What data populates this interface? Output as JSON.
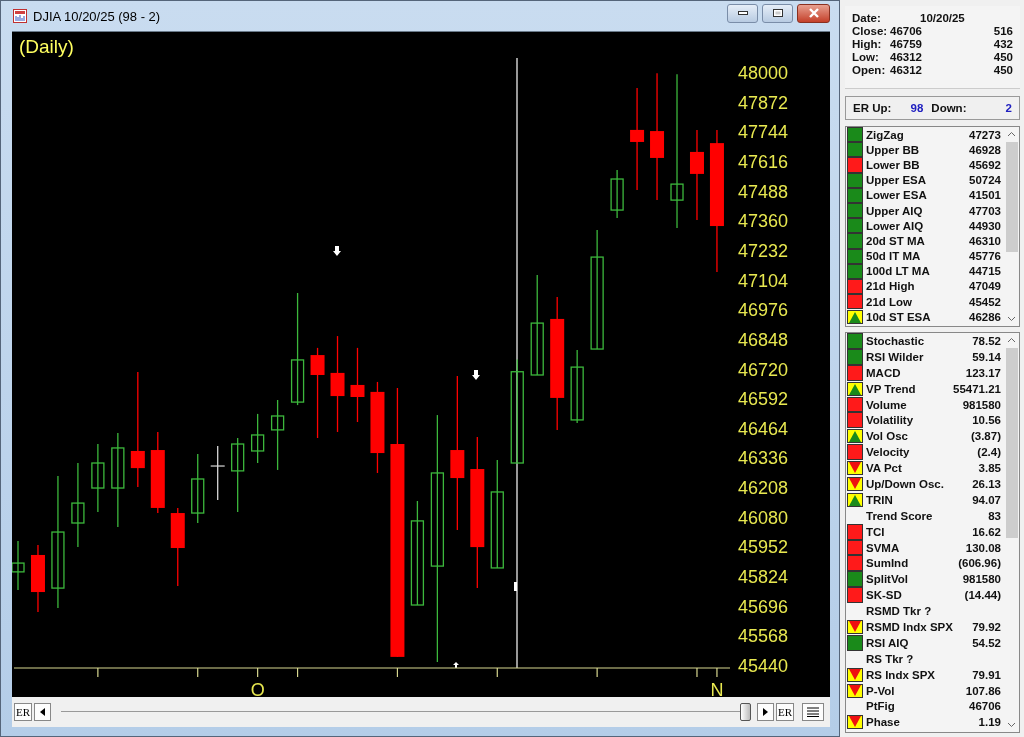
{
  "window": {
    "title": "DJIA 10/20/25 (98 - 2)"
  },
  "chart": {
    "period": "(Daily)",
    "chart_data": {
      "type": "candlestick",
      "ylim": [
        45440,
        48000
      ],
      "yticks": [
        48000,
        47872,
        47744,
        47616,
        47488,
        47360,
        47232,
        47104,
        46976,
        46848,
        46720,
        46592,
        46464,
        46336,
        46208,
        46080,
        45952,
        45824,
        45696,
        45568,
        45440
      ],
      "categories": [
        null,
        null,
        null,
        null,
        null,
        null,
        null,
        null,
        null,
        null,
        null,
        null,
        "O",
        null,
        null,
        null,
        null,
        null,
        null,
        null,
        null,
        null,
        null,
        null,
        null,
        null,
        null,
        null,
        null,
        null,
        null,
        null,
        null,
        null,
        null,
        "N"
      ],
      "ohlc": [
        [
          45842,
          45975,
          45764,
          45880
        ],
        [
          45915,
          45958,
          45669,
          45755
        ],
        [
          45772,
          46256,
          45686,
          46014
        ],
        [
          46053,
          46312,
          45949,
          46139
        ],
        [
          46204,
          46394,
          46101,
          46312
        ],
        [
          46204,
          46442,
          46036,
          46377
        ],
        [
          46364,
          46705,
          46208,
          46290
        ],
        [
          46368,
          46446,
          46096,
          46118
        ],
        [
          46096,
          46118,
          45781,
          45945
        ],
        [
          46096,
          46351,
          46053,
          46243
        ],
        [
          46299,
          46385,
          46152,
          46299
        ],
        [
          46278,
          46420,
          46101,
          46394
        ],
        [
          46364,
          46524,
          46312,
          46433
        ],
        [
          46455,
          46584,
          46282,
          46515
        ],
        [
          46575,
          47046,
          46562,
          46757
        ],
        [
          46778,
          46809,
          46420,
          46692
        ],
        [
          46701,
          46860,
          46446,
          46601
        ],
        [
          46649,
          46809,
          46489,
          46597
        ],
        [
          46619,
          46662,
          46269,
          46355
        ],
        [
          46394,
          46636,
          45475,
          45475
        ],
        [
          45699,
          46148,
          45699,
          46062
        ],
        [
          45867,
          46519,
          45453,
          46269
        ],
        [
          46368,
          46688,
          46023,
          46247
        ],
        [
          46286,
          46424,
          45772,
          45949
        ],
        [
          45859,
          46325,
          45859,
          46187
        ],
        [
          46312,
          46759,
          46312,
          46706
        ],
        [
          46692,
          47124,
          46692,
          46916
        ],
        [
          46934,
          47029,
          46455,
          46593
        ],
        [
          46498,
          46800,
          46485,
          46726
        ],
        [
          46804,
          47318,
          46804,
          47201
        ],
        [
          47404,
          47577,
          47370,
          47538
        ],
        [
          47750,
          47931,
          47491,
          47698
        ],
        [
          47745,
          47995,
          47447,
          47629
        ],
        [
          47447,
          47990,
          47327,
          47516
        ],
        [
          47655,
          47750,
          47361,
          47560
        ],
        [
          47693,
          47750,
          47137,
          47335
        ]
      ]
    }
  },
  "scrollbar": {
    "left_button": "ER",
    "right_button": "ER"
  },
  "info": {
    "date_label": "Date:",
    "date": "10/20/25",
    "rows": [
      {
        "label": "Close:",
        "value": "46706",
        "extra": "516"
      },
      {
        "label": "High:",
        "value": "46759",
        "extra": "432"
      },
      {
        "label": "Low:",
        "value": "46312",
        "extra": "450"
      },
      {
        "label": "Open:",
        "value": "46312",
        "extra": "450"
      }
    ]
  },
  "er": {
    "up_label": "ER Up:",
    "up": "98",
    "down_label": "Down:",
    "down": "2"
  },
  "indicators_1": [
    {
      "name": "ZigZag",
      "value": "47273",
      "kind": "square",
      "color": "#1a8a1a"
    },
    {
      "name": "Upper BB",
      "value": "46928",
      "kind": "square",
      "color": "#1a8a1a"
    },
    {
      "name": "Lower BB",
      "value": "45692",
      "kind": "square",
      "color": "#ff1a1a"
    },
    {
      "name": "Upper ESA",
      "value": "50724",
      "kind": "square",
      "color": "#1a8a1a"
    },
    {
      "name": "Lower ESA",
      "value": "41501",
      "kind": "square",
      "color": "#1a8a1a"
    },
    {
      "name": "Upper AIQ",
      "value": "47703",
      "kind": "square",
      "color": "#1a8a1a"
    },
    {
      "name": "Lower AIQ",
      "value": "44930",
      "kind": "square",
      "color": "#1a8a1a"
    },
    {
      "name": "20d ST MA",
      "value": "46310",
      "kind": "square",
      "color": "#1a8a1a"
    },
    {
      "name": "50d IT MA",
      "value": "45776",
      "kind": "square",
      "color": "#1a8a1a"
    },
    {
      "name": "100d LT MA",
      "value": "44715",
      "kind": "square",
      "color": "#1a8a1a"
    },
    {
      "name": "21d High",
      "value": "47049",
      "kind": "square",
      "color": "#ff1a1a"
    },
    {
      "name": "21d Low",
      "value": "45452",
      "kind": "square",
      "color": "#ff1a1a"
    },
    {
      "name": "10d ST ESA",
      "value": "46286",
      "kind": "up"
    }
  ],
  "indicators_2": [
    {
      "name": "Stochastic",
      "value": "78.52",
      "kind": "square",
      "color": "#1a8a1a"
    },
    {
      "name": "RSI Wilder",
      "value": "59.14",
      "kind": "square",
      "color": "#1a8a1a"
    },
    {
      "name": "MACD",
      "value": "123.17",
      "kind": "square",
      "color": "#ff1a1a"
    },
    {
      "name": "VP Trend",
      "value": "55471.21",
      "kind": "up"
    },
    {
      "name": "Volume",
      "value": "981580",
      "kind": "square",
      "color": "#ff1a1a"
    },
    {
      "name": "Volatility",
      "value": "10.56",
      "kind": "square",
      "color": "#ff1a1a"
    },
    {
      "name": "Vol Osc",
      "value": "(3.87)",
      "kind": "up"
    },
    {
      "name": "Velocity",
      "value": "(2.4)",
      "kind": "square",
      "color": "#ff1a1a"
    },
    {
      "name": "VA Pct",
      "value": "3.85",
      "kind": "down"
    },
    {
      "name": "Up/Down Osc.",
      "value": "26.13",
      "kind": "down"
    },
    {
      "name": "TRIN",
      "value": "94.07",
      "kind": "up"
    },
    {
      "name": "Trend Score",
      "value": "83"
    },
    {
      "name": "TCI",
      "value": "16.62",
      "kind": "square",
      "color": "#ff1a1a"
    },
    {
      "name": "SVMA",
      "value": "130.08",
      "kind": "square",
      "color": "#ff1a1a"
    },
    {
      "name": "SumInd",
      "value": "(606.96)",
      "kind": "square",
      "color": "#ff1a1a"
    },
    {
      "name": "SplitVol",
      "value": "981580",
      "kind": "square",
      "color": "#1a8a1a"
    },
    {
      "name": "SK-SD",
      "value": "(14.44)",
      "kind": "square",
      "color": "#ff1a1a"
    },
    {
      "name": "RSMD Tkr ?"
    },
    {
      "name": "RSMD Indx SPX",
      "value": "79.92",
      "kind": "down"
    },
    {
      "name": "RSI AIQ",
      "value": "54.52",
      "kind": "square",
      "color": "#1a8a1a"
    },
    {
      "name": "RS Tkr ?"
    },
    {
      "name": "RS Indx SPX",
      "value": "79.91",
      "kind": "down"
    },
    {
      "name": "P-Vol",
      "value": "107.86",
      "kind": "down"
    },
    {
      "name": "PtFig",
      "value": "46706"
    },
    {
      "name": "Phase",
      "value": "1.19",
      "kind": "down"
    }
  ]
}
